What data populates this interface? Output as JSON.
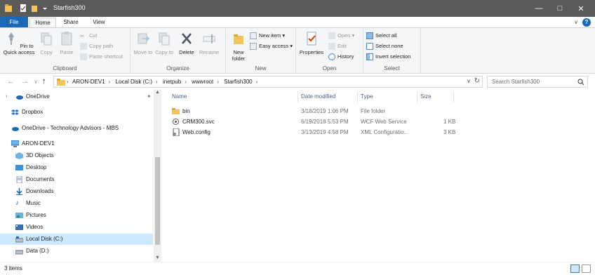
{
  "window": {
    "title": "Starfish300"
  },
  "ribbon_tabs": {
    "file": "File",
    "home": "Home",
    "share": "Share",
    "view": "View"
  },
  "ribbon": {
    "clipboard": {
      "label": "Clipboard",
      "pin": "Pin to Quick access",
      "copy": "Copy",
      "paste": "Paste",
      "cut": "Cut",
      "copy_path": "Copy path",
      "paste_shortcut": "Paste shortcut"
    },
    "organize": {
      "label": "Organize",
      "move_to": "Move to",
      "copy_to": "Copy to",
      "delete": "Delete",
      "rename": "Rename"
    },
    "new": {
      "label": "New",
      "new_folder": "New folder",
      "new_item": "New item",
      "easy_access": "Easy access"
    },
    "open": {
      "label": "Open",
      "properties": "Properties",
      "open": "Open",
      "edit": "Edit",
      "history": "History"
    },
    "select": {
      "label": "Select",
      "select_all": "Select all",
      "select_none": "Select none",
      "invert": "Invert selection"
    }
  },
  "address": {
    "crumbs": [
      "ARON-DEV1",
      "Local Disk (C:)",
      "inetpub",
      "wwwroot",
      "Starfish300"
    ],
    "search_placeholder": "Search Starfish300"
  },
  "nav": {
    "items": [
      {
        "label": "OneDrive",
        "icon": "onedrive-icon"
      },
      {
        "label": "Dropbox",
        "icon": "dropbox-icon"
      },
      {
        "label": "OneDrive - Technology Advisors - MBS",
        "icon": "onedrive-icon"
      },
      {
        "label": "ARON-DEV1",
        "icon": "computer-icon"
      },
      {
        "label": "3D Objects",
        "icon": "3d-objects-icon"
      },
      {
        "label": "Desktop",
        "icon": "desktop-icon"
      },
      {
        "label": "Documents",
        "icon": "documents-icon"
      },
      {
        "label": "Downloads",
        "icon": "downloads-icon"
      },
      {
        "label": "Music",
        "icon": "music-icon"
      },
      {
        "label": "Pictures",
        "icon": "pictures-icon"
      },
      {
        "label": "Videos",
        "icon": "videos-icon"
      },
      {
        "label": "Local Disk (C:)",
        "icon": "drive-icon"
      },
      {
        "label": "Data (D:)",
        "icon": "drive-icon"
      }
    ]
  },
  "columns": {
    "name": "Name",
    "date": "Date modified",
    "type": "Type",
    "size": "Size"
  },
  "files": [
    {
      "name": "bin",
      "date": "3/18/2019 1:06 PM",
      "type": "File folder",
      "size": "",
      "icon": "folder-icon"
    },
    {
      "name": "CRM300.svc",
      "date": "6/19/2018 5:53 PM",
      "type": "WCF Web Service",
      "size": "1 KB",
      "icon": "svc-file-icon"
    },
    {
      "name": "Web.config",
      "date": "3/13/2019 4:58 PM",
      "type": "XML Configuratio...",
      "size": "3 KB",
      "icon": "config-file-icon"
    }
  ],
  "status": {
    "count": "3 items"
  },
  "colors": {
    "accent": "#1a68b7",
    "titlebar": "#5a5a5a",
    "selection": "#cce8ff",
    "folder": "#f2c55c"
  }
}
